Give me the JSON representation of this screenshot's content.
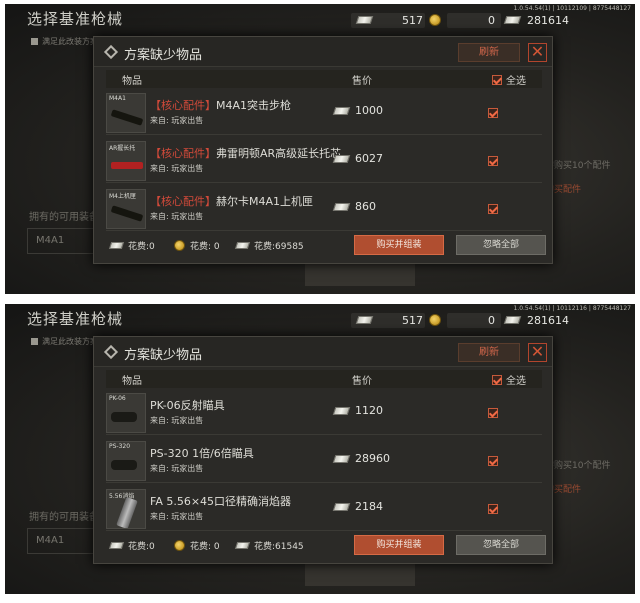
{
  "screens": [
    {
      "bg": {
        "title": "选择基准枪械",
        "sub": "满足此改装方案的枪械",
        "mid": "拥有的可用装备",
        "m4": "M4A1",
        "right1": "需购买10个配件",
        "right2": "购买配件"
      },
      "topbar": {
        "version": "1.0.54.54(1) | 10112109 | 8775448127",
        "cash1": "517",
        "coin": "0",
        "cash2": "281614"
      },
      "modal": {
        "title": "方案缺少物品",
        "refresh": "刷新",
        "col_item": "物品",
        "col_price": "售价",
        "col_select_all": "全选",
        "rows": [
          {
            "thumb_label": "M4A1",
            "tag": "【核心配件】",
            "name": "M4A1突击步枪",
            "source": "来自:  玩家出售",
            "price": "1000",
            "thumb": "rifle"
          },
          {
            "thumb_label": "AR握长托",
            "tag": "【核心配件】",
            "name": "弗雷明顿AR高级延长托芯",
            "source": "来自:  玩家出售",
            "price": "6027",
            "thumb": "red"
          },
          {
            "thumb_label": "M4上机匣",
            "tag": "【核心配件】",
            "name": "赫尔卡M4A1上机匣",
            "source": "来自:  玩家出售",
            "price": "860",
            "thumb": "rifle"
          }
        ],
        "footer": {
          "cost1": "花费:0",
          "cost2": "花费: 0",
          "cost3": "花费:69585",
          "buy": "购买并组装",
          "ignore": "忽略全部"
        }
      }
    },
    {
      "bg": {
        "title": "选择基准枪械",
        "sub": "满足此改装方案的枪械",
        "mid": "拥有的可用装备",
        "m4": "M4A1",
        "right1": "需购买10个配件",
        "right2": "购买配件"
      },
      "topbar": {
        "version": "1.0.54.54(1) | 10112116 | 8775448127",
        "cash1": "517",
        "coin": "0",
        "cash2": "281614"
      },
      "modal": {
        "title": "方案缺少物品",
        "refresh": "刷新",
        "col_item": "物品",
        "col_price": "售价",
        "col_select_all": "全选",
        "rows": [
          {
            "thumb_label": "PK-06",
            "tag": "",
            "name": "PK-06反射瞄具",
            "source": "来自:  玩家出售",
            "price": "1120",
            "thumb": "scope"
          },
          {
            "thumb_label": "PS-320",
            "tag": "",
            "name": "PS-320 1倍/6倍瞄具",
            "source": "来自:  玩家出售",
            "price": "28960",
            "thumb": "scope"
          },
          {
            "thumb_label": "5.56消焰",
            "tag": "",
            "name": "FA 5.56×45口径精确消焰器",
            "source": "来自:  玩家出售",
            "price": "2184",
            "thumb": "pipe"
          }
        ],
        "footer": {
          "cost1": "花费:0",
          "cost2": "花费: 0",
          "cost3": "花费:61545",
          "buy": "购买并组装",
          "ignore": "忽略全部"
        }
      }
    }
  ]
}
